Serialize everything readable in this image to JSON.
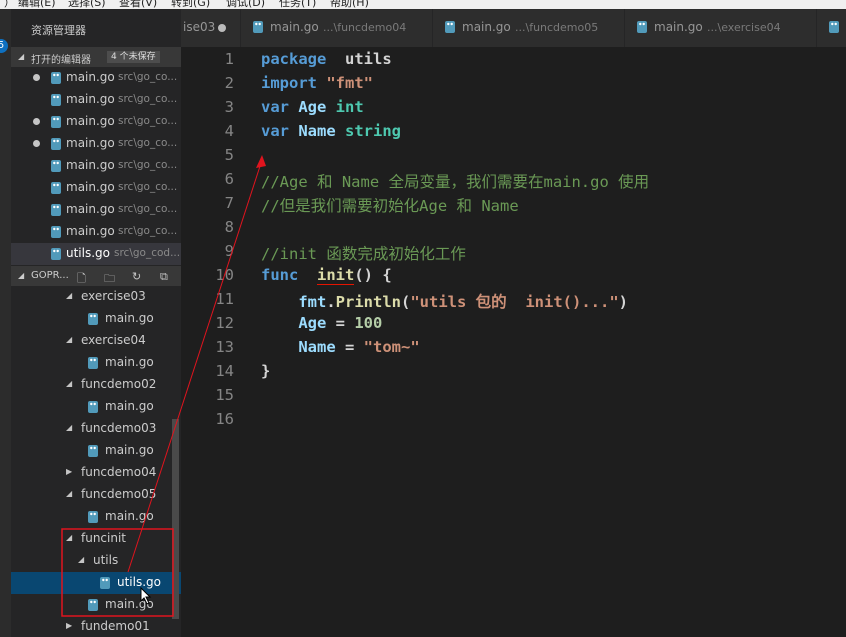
{
  "menu": [
    "）",
    "编辑(E)",
    "选择(S)",
    "查看(V)",
    "转到(G)",
    "调试(D)",
    "任务(T)",
    "帮助(H)"
  ],
  "sidebar": {
    "title": "资源管理器",
    "open_editors": {
      "label": "打开的编辑器",
      "count": "4 个未保存",
      "items": [
        {
          "name": "main.go",
          "path": "src\\go_co...",
          "dirty": true
        },
        {
          "name": "main.go",
          "path": "src\\go_co...",
          "dirty": false
        },
        {
          "name": "main.go",
          "path": "src\\go_co...",
          "dirty": true
        },
        {
          "name": "main.go",
          "path": "src\\go_co...",
          "dirty": true
        },
        {
          "name": "main.go",
          "path": "src\\go_co...",
          "dirty": false
        },
        {
          "name": "main.go",
          "path": "src\\go_co...",
          "dirty": false
        },
        {
          "name": "main.go",
          "path": "src\\go_co...",
          "dirty": false
        },
        {
          "name": "main.go",
          "path": "src\\go_co...",
          "dirty": false
        },
        {
          "name": "utils.go",
          "path": "src\\go_cod...",
          "dirty": false
        }
      ]
    },
    "workspace": {
      "label": "GOPR...",
      "icons": [
        "new-file-icon",
        "new-folder-icon",
        "refresh-icon",
        "collapse-all-icon"
      ],
      "tree": [
        {
          "name": "exercise03",
          "type": "folder",
          "indent": 1,
          "open": true
        },
        {
          "name": "main.go",
          "type": "file",
          "indent": 2
        },
        {
          "name": "exercise04",
          "type": "folder",
          "indent": 1,
          "open": true
        },
        {
          "name": "main.go",
          "type": "file",
          "indent": 2
        },
        {
          "name": "funcdemo02",
          "type": "folder",
          "indent": 1,
          "open": true
        },
        {
          "name": "main.go",
          "type": "file",
          "indent": 2
        },
        {
          "name": "funcdemo03",
          "type": "folder",
          "indent": 1,
          "open": true
        },
        {
          "name": "main.go",
          "type": "file",
          "indent": 2
        },
        {
          "name": "funcdemo04",
          "type": "folder",
          "indent": 1,
          "open": false
        },
        {
          "name": "funcdemo05",
          "type": "folder",
          "indent": 1,
          "open": true
        },
        {
          "name": "main.go",
          "type": "file",
          "indent": 2
        },
        {
          "name": "funcinit",
          "type": "folder",
          "indent": 1,
          "open": true
        },
        {
          "name": "utils",
          "type": "folder",
          "indent": 2,
          "open": true
        },
        {
          "name": "utils.go",
          "type": "file",
          "indent": 3,
          "selected": true
        },
        {
          "name": "main.go",
          "type": "file",
          "indent": 2
        },
        {
          "name": "fundemo01",
          "type": "folder",
          "indent": 1,
          "open": false
        }
      ]
    }
  },
  "tabs": [
    {
      "name": "ise03",
      "path": "",
      "dirty": true
    },
    {
      "name": "main.go",
      "path": "...\\funcdemo04",
      "dirty": false
    },
    {
      "name": "main.go",
      "path": "...\\funcdemo05",
      "dirty": false
    },
    {
      "name": "main.go",
      "path": "...\\exercise04",
      "dirty": false
    },
    {
      "name": "m",
      "path": "",
      "dirty": false
    }
  ],
  "code": [
    [
      [
        "kw b",
        "package"
      ],
      [
        "",
        "  "
      ],
      [
        "b",
        "utils"
      ]
    ],
    [
      [
        "kw b",
        "import"
      ],
      [
        "",
        ""
      ],
      [
        "str b",
        " \"fmt\""
      ]
    ],
    [
      [
        "kw b",
        "var"
      ],
      [
        "id b",
        " Age"
      ],
      [
        "ty b",
        " int"
      ]
    ],
    [
      [
        "kw b",
        "var"
      ],
      [
        "id b",
        " Name"
      ],
      [
        "ty b",
        " string"
      ]
    ],
    [],
    [
      [
        "cmt",
        "//Age 和 Name 全局变量，我们需要在main.go 使用"
      ]
    ],
    [
      [
        "cmt",
        "//但是我们需要初始化Age 和 Name"
      ]
    ],
    [],
    [
      [
        "cmt",
        "//init 函数完成初始化工作"
      ]
    ],
    [
      [
        "kw b",
        "func"
      ],
      [
        "",
        "  "
      ],
      [
        "fn b squig",
        "init"
      ],
      [
        "b",
        "() {"
      ]
    ],
    [
      [
        "",
        "    "
      ],
      [
        "id b",
        "fmt"
      ],
      [
        "b",
        "."
      ],
      [
        "fn b",
        "Println"
      ],
      [
        "b",
        "("
      ],
      [
        "str b",
        "\"utils 包的  init()...\""
      ],
      [
        "b",
        ")"
      ]
    ],
    [
      [
        "",
        "    "
      ],
      [
        "id b",
        "Age"
      ],
      [
        "b",
        " = "
      ],
      [
        "num b",
        "100"
      ]
    ],
    [
      [
        "",
        "    "
      ],
      [
        "id b",
        "Name"
      ],
      [
        "b",
        " = "
      ],
      [
        "str b",
        "\"tom~\""
      ]
    ],
    [
      [
        "b",
        "}"
      ]
    ],
    [],
    []
  ],
  "colors": {
    "accent": "#094771",
    "annotation": "#e0141e"
  }
}
